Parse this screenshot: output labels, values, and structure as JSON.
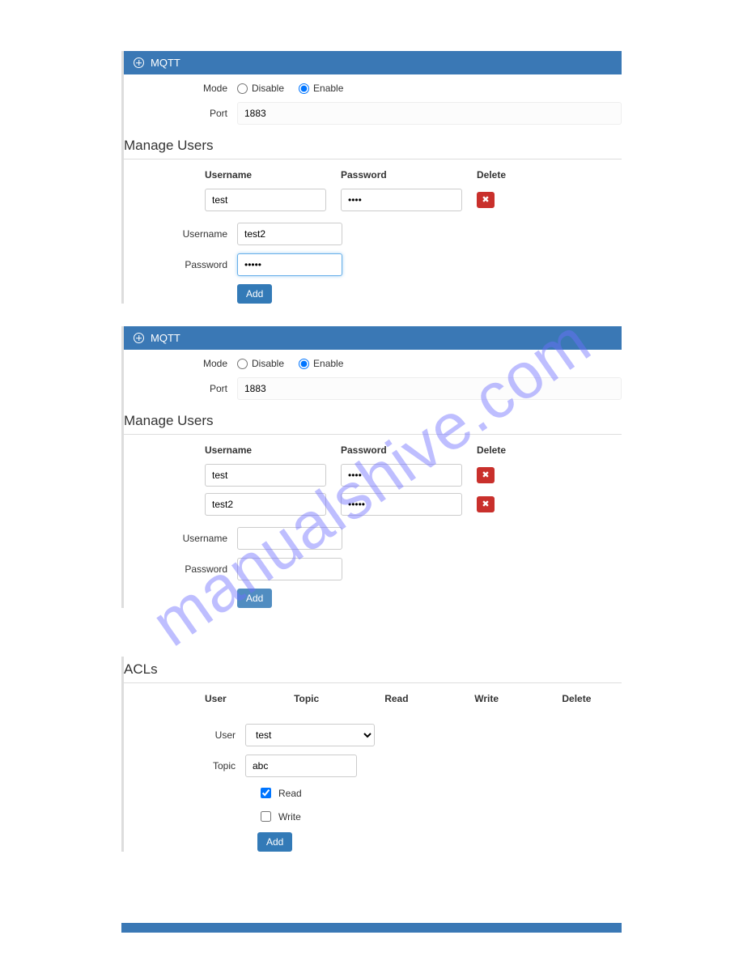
{
  "watermark": "manualshive.com",
  "panel1": {
    "title": "MQTT",
    "mode_label": "Mode",
    "mode_disable": "Disable",
    "mode_enable": "Enable",
    "mode_selected": "enable",
    "port_label": "Port",
    "port_value": "1883",
    "manage_users_title": "Manage Users",
    "table_headers": {
      "username": "Username",
      "password": "Password",
      "delete": "Delete"
    },
    "users": [
      {
        "username": "test",
        "password": "••••"
      }
    ],
    "add": {
      "username_label": "Username",
      "username_value": "test2",
      "password_label": "Password",
      "password_value": "•••••",
      "button": "Add"
    }
  },
  "panel2": {
    "title": "MQTT",
    "mode_label": "Mode",
    "mode_disable": "Disable",
    "mode_enable": "Enable",
    "mode_selected": "enable",
    "port_label": "Port",
    "port_value": "1883",
    "manage_users_title": "Manage Users",
    "table_headers": {
      "username": "Username",
      "password": "Password",
      "delete": "Delete"
    },
    "users": [
      {
        "username": "test",
        "password": "••••"
      },
      {
        "username": "test2",
        "password": "•••••"
      }
    ],
    "add": {
      "username_label": "Username",
      "username_value": "",
      "password_label": "Password",
      "password_value": "",
      "button": "Add"
    }
  },
  "acls": {
    "title": "ACLs",
    "headers": {
      "user": "User",
      "topic": "Topic",
      "read": "Read",
      "write": "Write",
      "delete": "Delete"
    },
    "form": {
      "user_label": "User",
      "user_value": "test",
      "topic_label": "Topic",
      "topic_value": "abc",
      "read_label": "Read",
      "read_checked": true,
      "write_label": "Write",
      "write_checked": false,
      "button": "Add"
    }
  }
}
